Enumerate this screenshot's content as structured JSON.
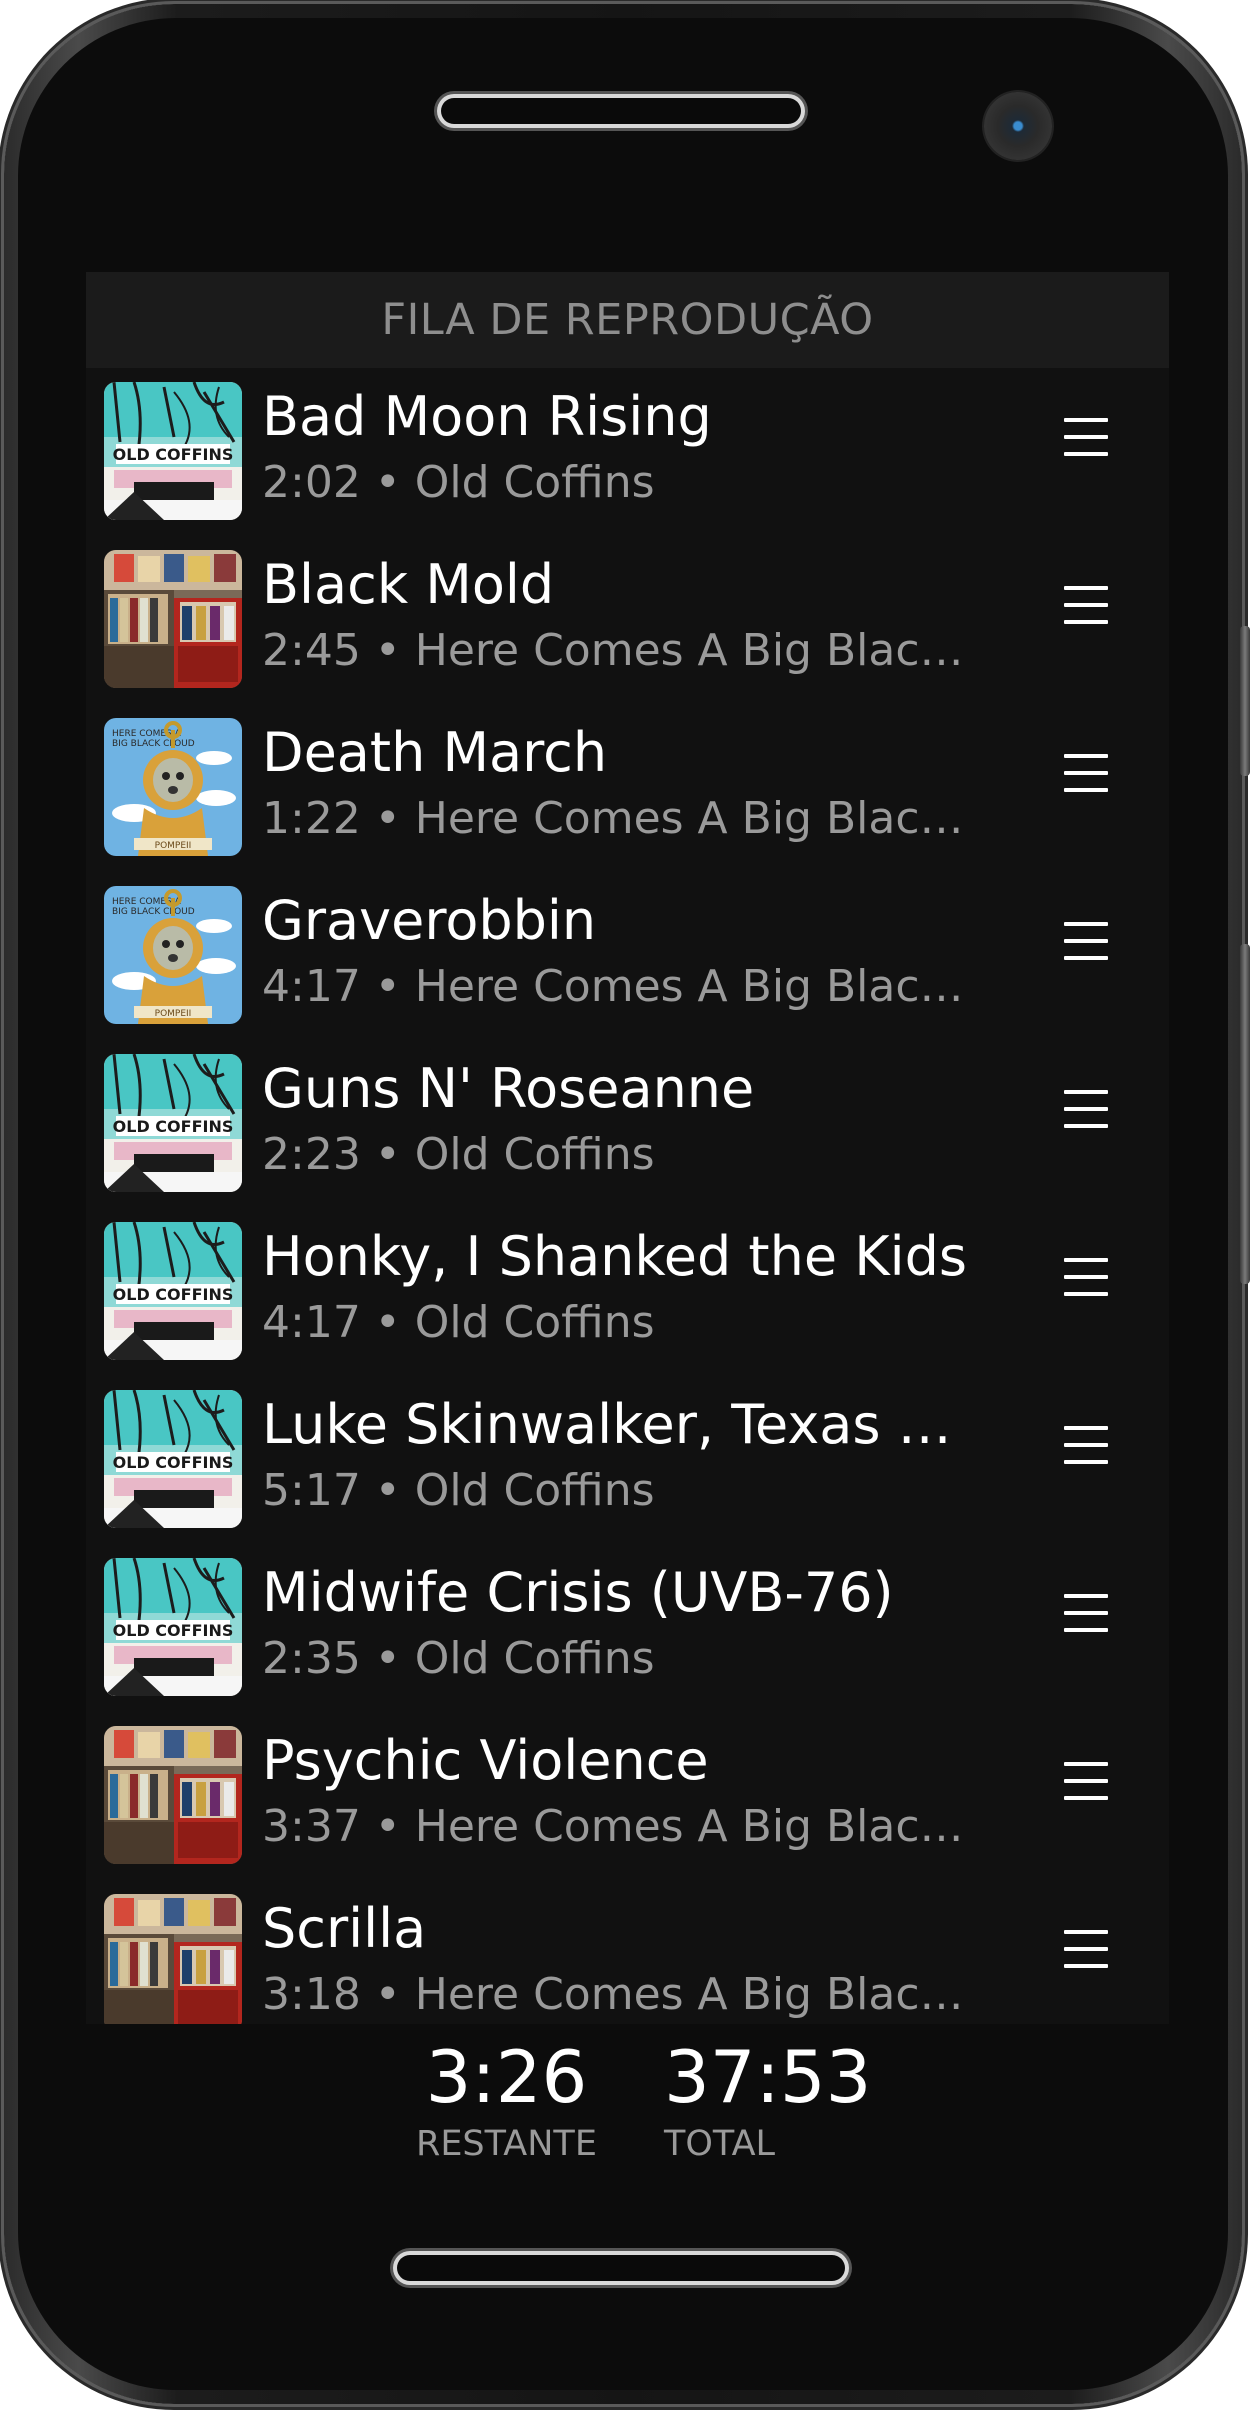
{
  "header": {
    "title": "FILA DE REPRODUÇÃO"
  },
  "queue": [
    {
      "title": "Bad Moon Rising",
      "duration": "2:02",
      "album": "Old Coffins",
      "subtitle": "2:02 • Old Coffins",
      "art": "old-coffins"
    },
    {
      "title": "Black Mold",
      "duration": "2:45",
      "album": "Here Comes A Big Black Cl...",
      "subtitle": "2:45 • Here Comes A Big Black Cl...",
      "art": "big-black-cloud"
    },
    {
      "title": "Death March",
      "duration": "1:22",
      "album": "Here Comes A Big Black Cl...",
      "subtitle": "1:22 • Here Comes A Big Black Cl...",
      "art": "pompeii"
    },
    {
      "title": "Graverobbin",
      "duration": "4:17",
      "album": "Here Comes A Big Black Cl...",
      "subtitle": "4:17 • Here Comes A Big Black Cl...",
      "art": "pompeii"
    },
    {
      "title": "Guns N' Roseanne",
      "duration": "2:23",
      "album": "Old Coffins",
      "subtitle": "2:23 • Old Coffins",
      "art": "old-coffins"
    },
    {
      "title": "Honky, I Shanked the Kids",
      "duration": "4:17",
      "album": "Old Coffins",
      "subtitle": "4:17 • Old Coffins",
      "art": "old-coffins"
    },
    {
      "title": "Luke Skinwalker, Texas Ran...",
      "duration": "5:17",
      "album": "Old Coffins",
      "subtitle": "5:17 • Old Coffins",
      "art": "old-coffins"
    },
    {
      "title": "Midwife Crisis (UVB-76)",
      "duration": "2:35",
      "album": "Old Coffins",
      "subtitle": "2:35 • Old Coffins",
      "art": "old-coffins"
    },
    {
      "title": "Psychic Violence",
      "duration": "3:37",
      "album": "Here Comes A Big Black Cl...",
      "subtitle": "3:37 • Here Comes A Big Black Cl...",
      "art": "big-black-cloud"
    },
    {
      "title": "Scrilla",
      "duration": "3:18",
      "album": "Here Comes A Big Black Cl...",
      "subtitle": "3:18 • Here Comes A Big Black Cl...",
      "art": "big-black-cloud"
    }
  ],
  "footer": {
    "remaining_value": "3:26",
    "remaining_label": "RESTANTE",
    "total_value": "37:53",
    "total_label": "TOTAL"
  },
  "icons": {
    "reorder": "drag-handle-icon"
  },
  "colors": {
    "background": "#111111",
    "header": "#1b1b1b",
    "text": "#ffffff",
    "secondary_text": "#9a9a9a"
  }
}
